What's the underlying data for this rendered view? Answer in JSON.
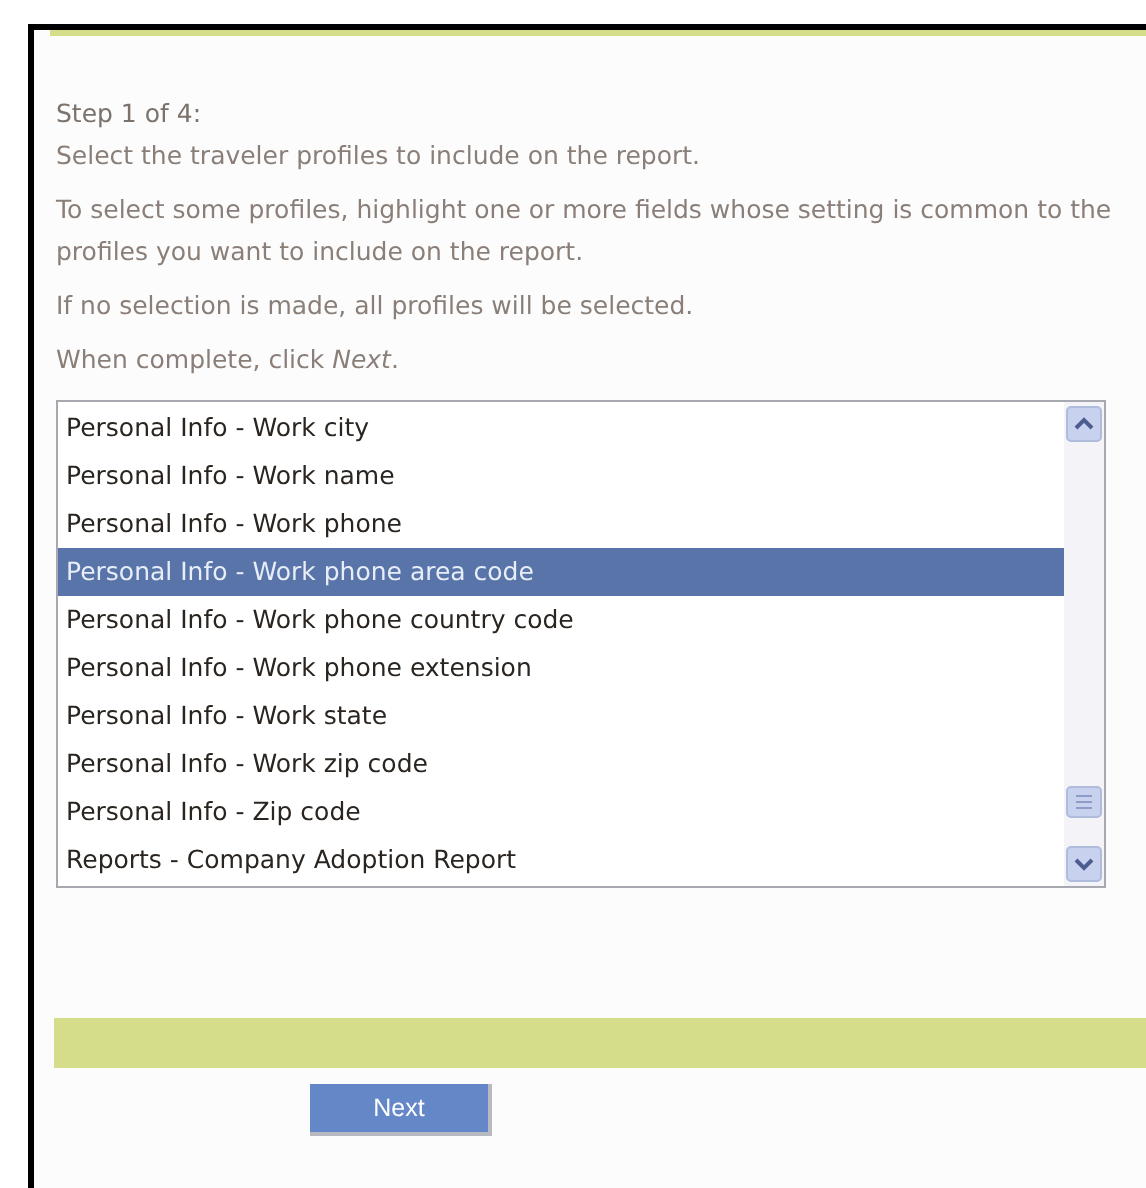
{
  "step": "Step 1 of 4:",
  "instructions": [
    "Select the traveler profiles to include on the report.",
    "To select some profiles, highlight one or more fields whose setting is common to the profiles you want to include on the report.",
    "If no selection is made, all profiles will be selected.",
    "When complete, click *Next*."
  ],
  "fields": [
    {
      "label": "Personal Info - Work city",
      "selected": false
    },
    {
      "label": "Personal Info - Work name",
      "selected": false
    },
    {
      "label": "Personal Info - Work phone",
      "selected": false
    },
    {
      "label": "Personal Info - Work phone area code",
      "selected": true
    },
    {
      "label": "Personal Info - Work phone country code",
      "selected": false
    },
    {
      "label": "Personal Info - Work phone extension",
      "selected": false
    },
    {
      "label": "Personal Info - Work state",
      "selected": false
    },
    {
      "label": "Personal Info - Work zip code",
      "selected": false
    },
    {
      "label": "Personal Info - Zip code",
      "selected": false
    },
    {
      "label": "Reports - Company Adoption Report",
      "selected": false
    }
  ],
  "next_button": "Next"
}
